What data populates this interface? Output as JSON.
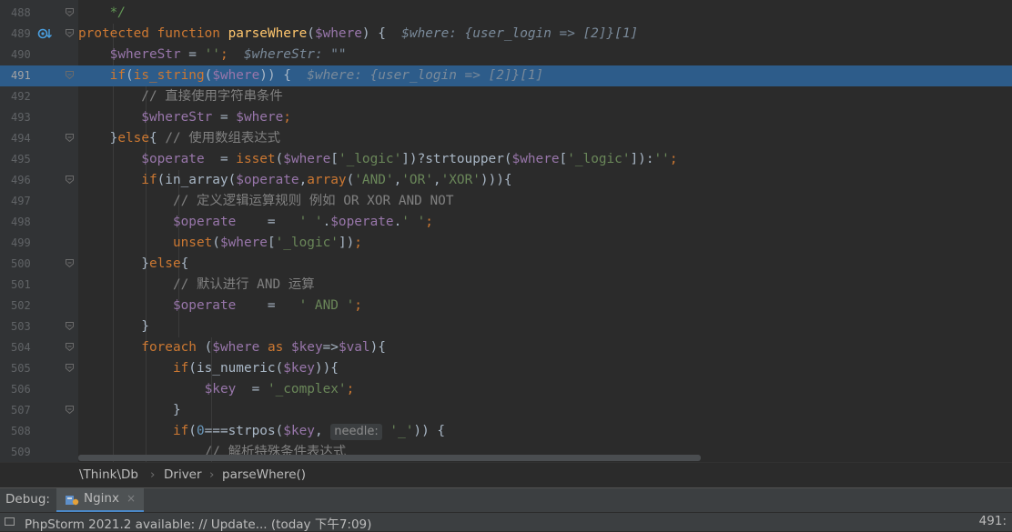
{
  "editor": {
    "lines": [
      {
        "num": "488",
        "tokens": [
          [
            "doc",
            "    */"
          ]
        ]
      },
      {
        "num": "489",
        "tokens": [
          [
            "kw",
            "protected function "
          ],
          [
            "fn",
            "parseWhere"
          ],
          [
            "plain",
            "("
          ],
          [
            "var",
            "$where"
          ],
          [
            "plain",
            ") {  "
          ],
          [
            "inline",
            "$where: {user_login => [2]}[1]"
          ]
        ]
      },
      {
        "num": "490",
        "tokens": [
          [
            "var",
            "    $whereStr"
          ],
          [
            "plain",
            " = "
          ],
          [
            "str",
            "''"
          ],
          [
            "kw",
            ";"
          ],
          [
            "plain",
            "  "
          ],
          [
            "inline",
            "$whereStr: \"\""
          ]
        ]
      },
      {
        "num": "491",
        "tokens": [
          [
            "kw",
            "    if"
          ],
          [
            "plain",
            "("
          ],
          [
            "kw",
            "is_string"
          ],
          [
            "plain",
            "("
          ],
          [
            "var",
            "$where"
          ],
          [
            "plain",
            ")) {  "
          ],
          [
            "inline",
            "$where: {user_login => [2]}[1]"
          ]
        ]
      },
      {
        "num": "492",
        "tokens": [
          [
            "cmt",
            "        // 直接使用字符串条件"
          ]
        ]
      },
      {
        "num": "493",
        "tokens": [
          [
            "var",
            "        $whereStr"
          ],
          [
            "plain",
            " = "
          ],
          [
            "var",
            "$where"
          ],
          [
            "kw",
            ";"
          ]
        ]
      },
      {
        "num": "494",
        "tokens": [
          [
            "plain",
            "    }"
          ],
          [
            "kw",
            "else"
          ],
          [
            "plain",
            "{ "
          ],
          [
            "cmt",
            "// 使用数组表达式"
          ]
        ]
      },
      {
        "num": "495",
        "tokens": [
          [
            "var",
            "        $operate"
          ],
          [
            "plain",
            "  = "
          ],
          [
            "kw",
            "isset"
          ],
          [
            "plain",
            "("
          ],
          [
            "var",
            "$where"
          ],
          [
            "plain",
            "["
          ],
          [
            "str",
            "'_logic'"
          ],
          [
            "plain",
            "])?strtoupper("
          ],
          [
            "var",
            "$where"
          ],
          [
            "plain",
            "["
          ],
          [
            "str",
            "'_logic'"
          ],
          [
            "plain",
            "]):"
          ],
          [
            "str",
            "''"
          ],
          [
            "kw",
            ";"
          ]
        ]
      },
      {
        "num": "496",
        "tokens": [
          [
            "kw",
            "        if"
          ],
          [
            "plain",
            "(in_array("
          ],
          [
            "var",
            "$operate"
          ],
          [
            "plain",
            ","
          ],
          [
            "kw",
            "array"
          ],
          [
            "plain",
            "("
          ],
          [
            "str",
            "'AND'"
          ],
          [
            "plain",
            ","
          ],
          [
            "str",
            "'OR'"
          ],
          [
            "plain",
            ","
          ],
          [
            "str",
            "'XOR'"
          ],
          [
            "plain",
            ")))"
          ],
          [
            "plain",
            "{"
          ]
        ]
      },
      {
        "num": "497",
        "tokens": [
          [
            "cmt",
            "            // 定义逻辑运算规则 例如 OR XOR AND NOT"
          ]
        ]
      },
      {
        "num": "498",
        "tokens": [
          [
            "var",
            "            $operate"
          ],
          [
            "plain",
            "    =   "
          ],
          [
            "str",
            "' '"
          ],
          [
            "plain",
            "."
          ],
          [
            "var",
            "$operate"
          ],
          [
            "plain",
            "."
          ],
          [
            "str",
            "' '"
          ],
          [
            "kw",
            ";"
          ]
        ]
      },
      {
        "num": "499",
        "tokens": [
          [
            "kw",
            "            unset"
          ],
          [
            "plain",
            "("
          ],
          [
            "var",
            "$where"
          ],
          [
            "plain",
            "["
          ],
          [
            "str",
            "'_logic'"
          ],
          [
            "plain",
            "])"
          ],
          [
            "kw",
            ";"
          ]
        ]
      },
      {
        "num": "500",
        "tokens": [
          [
            "plain",
            "        }"
          ],
          [
            "kw",
            "else"
          ],
          [
            "plain",
            "{"
          ]
        ]
      },
      {
        "num": "501",
        "tokens": [
          [
            "cmt",
            "            // 默认进行 AND 运算"
          ]
        ]
      },
      {
        "num": "502",
        "tokens": [
          [
            "var",
            "            $operate"
          ],
          [
            "plain",
            "    =   "
          ],
          [
            "str",
            "' AND '"
          ],
          [
            "kw",
            ";"
          ]
        ]
      },
      {
        "num": "503",
        "tokens": [
          [
            "plain",
            "        }"
          ]
        ]
      },
      {
        "num": "504",
        "tokens": [
          [
            "kw",
            "        foreach "
          ],
          [
            "plain",
            "("
          ],
          [
            "var",
            "$where "
          ],
          [
            "kw",
            "as "
          ],
          [
            "var",
            "$key"
          ],
          [
            "plain",
            "=>"
          ],
          [
            "var",
            "$val"
          ],
          [
            "plain",
            "){"
          ]
        ]
      },
      {
        "num": "505",
        "tokens": [
          [
            "kw",
            "            if"
          ],
          [
            "plain",
            "(is_numeric("
          ],
          [
            "var",
            "$key"
          ],
          [
            "plain",
            "))"
          ],
          [
            "plain",
            "{"
          ]
        ]
      },
      {
        "num": "506",
        "tokens": [
          [
            "var",
            "                $key"
          ],
          [
            "plain",
            "  = "
          ],
          [
            "str",
            "'_complex'"
          ],
          [
            "kw",
            ";"
          ]
        ]
      },
      {
        "num": "507",
        "tokens": [
          [
            "plain",
            "            }"
          ]
        ]
      },
      {
        "num": "508",
        "tokens": [
          [
            "kw",
            "            if"
          ],
          [
            "plain",
            "("
          ],
          [
            "num",
            "0"
          ],
          [
            "plain",
            "===strpos("
          ],
          [
            "var",
            "$key"
          ],
          [
            "plain",
            ", "
          ],
          [
            "hint",
            "needle:"
          ],
          [
            "str",
            " '_'"
          ],
          [
            "plain",
            ")) {"
          ]
        ]
      },
      {
        "num": "509",
        "tokens": [
          [
            "cmt",
            "                // 解析特殊条件表达式"
          ]
        ]
      }
    ],
    "current_line": "491"
  },
  "breadcrumbs": {
    "items": [
      "\\Think\\Db",
      "Driver",
      "parseWhere()"
    ],
    "separator": "›"
  },
  "debug": {
    "label": "Debug:",
    "tab_label": "Nginx",
    "tab_close": "×"
  },
  "status": {
    "message": "PhpStorm 2021.2 available: // Update... (today 下午7:09)",
    "position": "491:"
  }
}
